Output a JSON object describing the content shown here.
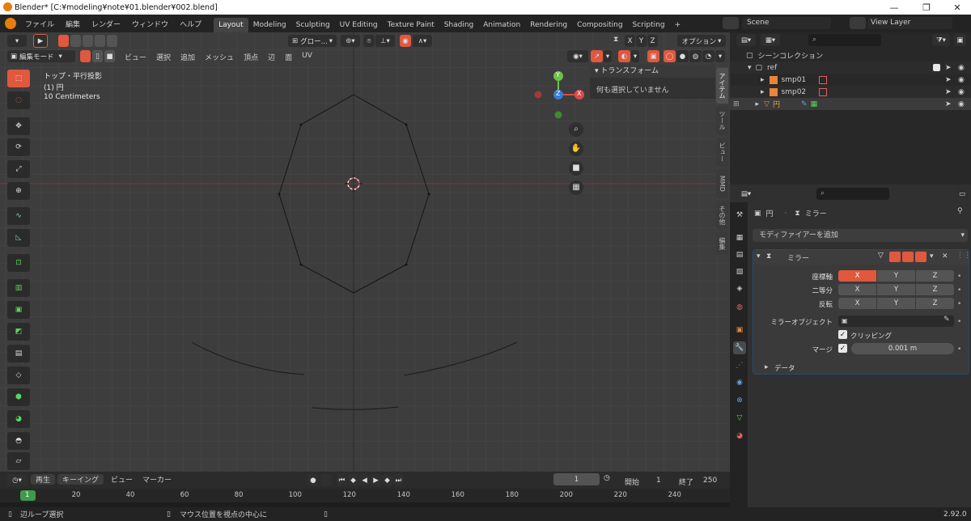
{
  "window": {
    "title": "Blender* [C:¥modeling¥note¥01.blender¥002.blend]"
  },
  "menu": [
    "ファイル",
    "編集",
    "レンダー",
    "ウィンドウ",
    "ヘルプ"
  ],
  "workspaces": [
    "Layout",
    "Modeling",
    "Sculpting",
    "UV Editing",
    "Texture Paint",
    "Shading",
    "Animation",
    "Rendering",
    "Compositing",
    "Scripting",
    "+"
  ],
  "scene": {
    "label": "Scene",
    "view_layer": "View Layer"
  },
  "viewport": {
    "orientation": "グロー...",
    "mode": "編集モード",
    "menus": [
      "ビュー",
      "選択",
      "追加",
      "メッシュ",
      "頂点",
      "辺",
      "面",
      "UV"
    ],
    "xyz": [
      "X",
      "Y",
      "Z"
    ],
    "options": "オプション",
    "overlay_lines": [
      "トップ・平行投影",
      "(1) 円",
      "10 Centimeters"
    ],
    "gizmo": {
      "x": "X",
      "y": "Y",
      "z": "Z"
    },
    "npanel": {
      "header": "トランスフォーム",
      "body": "何も選択していません"
    },
    "side_tabs": [
      "アイテム",
      "ツール",
      "ビュー",
      "MMD",
      "その他",
      "編集"
    ]
  },
  "outliner": {
    "header": "シーンコレクション",
    "items": [
      {
        "label": "ref"
      },
      {
        "label": "smp01"
      },
      {
        "label": "smp02"
      },
      {
        "label": "円"
      }
    ]
  },
  "properties": {
    "breadcrumb_object": "円",
    "breadcrumb_modifier": "ミラー",
    "add_modifier": "モディファイアーを追加",
    "modifier_name": "ミラー",
    "rows": [
      {
        "label": "座標軸",
        "x": "X",
        "y": "Y",
        "z": "Z"
      },
      {
        "label": "二等分",
        "x": "X",
        "y": "Y",
        "z": "Z"
      },
      {
        "label": "反転",
        "x": "X",
        "y": "Y",
        "z": "Z"
      }
    ],
    "mirror_object_label": "ミラーオブジェクト",
    "clipping_label": "クリッピング",
    "merge_label": "マージ",
    "merge_value": "0.001 m",
    "data_label": "データ"
  },
  "timeline": {
    "menus": [
      "再生",
      "キーイング",
      "ビュー",
      "マーカー"
    ],
    "current_frame": "1",
    "start_label": "開始",
    "start": "1",
    "end_label": "終了",
    "end": "250",
    "ticks": [
      "1",
      "20",
      "40",
      "60",
      "80",
      "100",
      "120",
      "140",
      "160",
      "180",
      "200",
      "220",
      "240"
    ]
  },
  "status": {
    "left": "辺ループ選択",
    "middle": "マウス位置を視点の中心に",
    "version": "2.92.0"
  },
  "colors": {
    "accent": "#e0583e",
    "viewport_bg": "#3d3d3d",
    "mesh_edge": "#111111"
  }
}
